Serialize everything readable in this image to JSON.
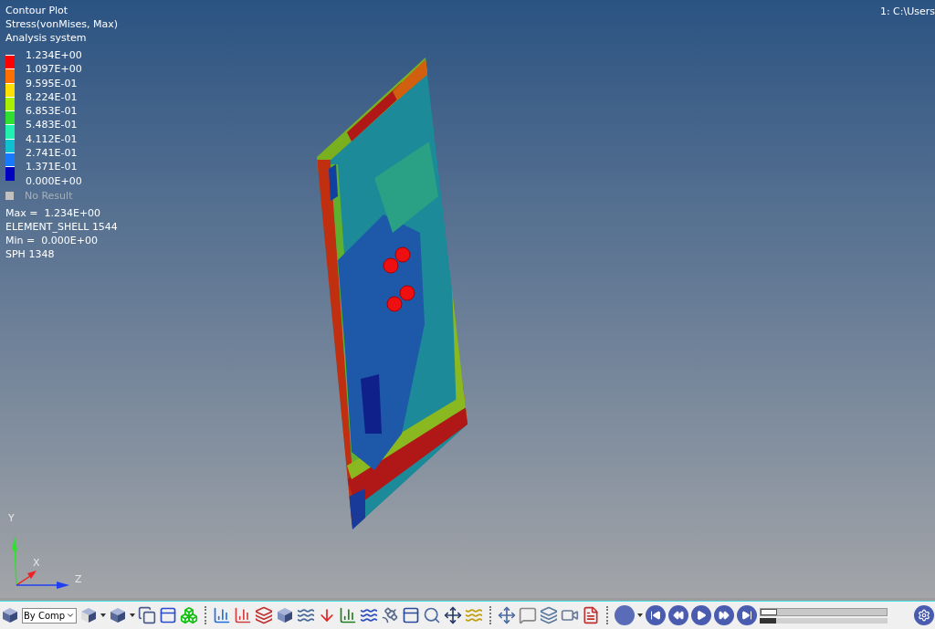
{
  "viewport": {
    "title_lines": [
      "Contour Plot",
      "Stress(vonMises, Max)",
      "Analysis system"
    ],
    "file_label": "1: C:\\Users",
    "legend": {
      "labels": [
        "1.234E+00",
        "1.097E+00",
        "9.595E-01",
        "8.224E-01",
        "6.853E-01",
        "5.483E-01",
        "4.112E-01",
        "2.741E-01",
        "1.371E-01",
        "0.000E+00"
      ],
      "bands": [
        {
          "color": "#ff0000"
        },
        {
          "color": "#ff7000"
        },
        {
          "color": "#ffe000"
        },
        {
          "color": "#a8f000"
        },
        {
          "color": "#30e030"
        },
        {
          "color": "#20f0b0"
        },
        {
          "color": "#10c0d0"
        },
        {
          "color": "#1878ff"
        },
        {
          "color": "#0000c0"
        }
      ],
      "no_result": "No Result"
    },
    "stats": [
      "Max =  1.234E+00",
      "ELEMENT_SHELL 1544",
      "Min =  0.000E+00",
      "SPH 1348"
    ],
    "axes": {
      "y": "Y",
      "x": "X",
      "z": "Z"
    }
  },
  "toolbar": {
    "color_mode": "By Comp",
    "animation_slider": {
      "level": 0.13
    },
    "step_slider": {
      "level": 0.13
    }
  }
}
